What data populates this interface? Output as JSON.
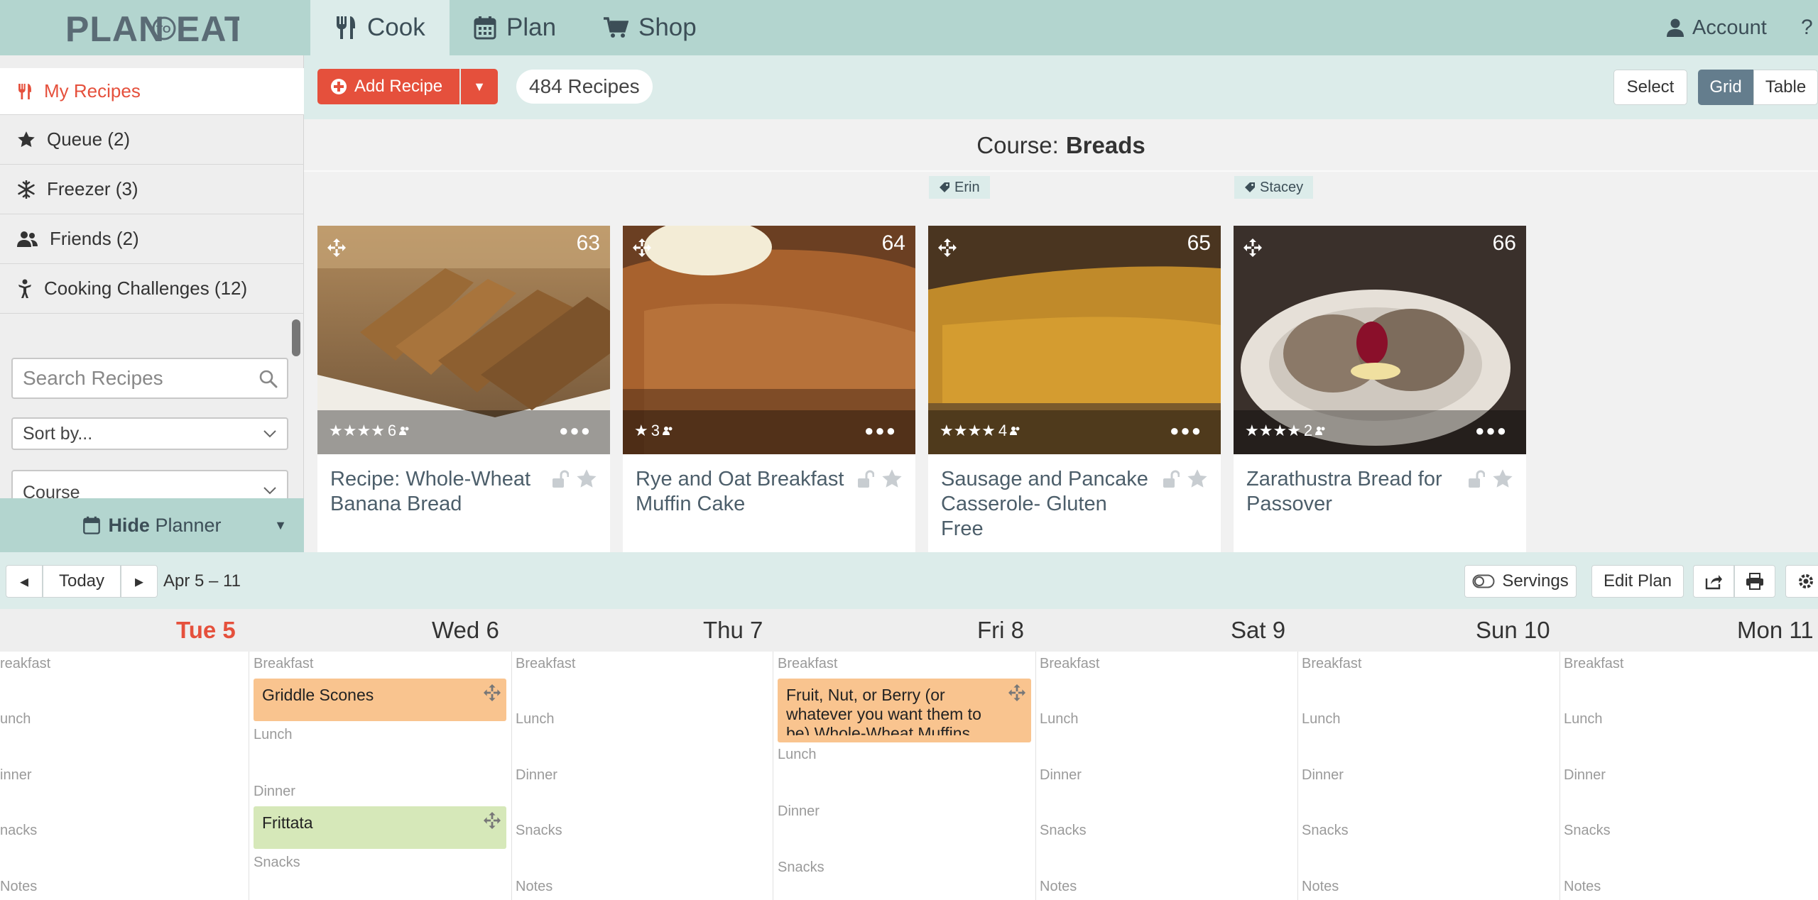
{
  "app": {
    "logo_text": "PLAN TO EAT"
  },
  "nav": {
    "tabs": [
      {
        "label": "Cook",
        "active": true
      },
      {
        "label": "Plan",
        "active": false
      },
      {
        "label": "Shop",
        "active": false
      }
    ],
    "account_label": "Account",
    "help_label": "?"
  },
  "sidebar": {
    "items": [
      {
        "label": "My Recipes",
        "icon": "fork-knife-icon",
        "active": true
      },
      {
        "label": "Queue (2)",
        "icon": "star-icon"
      },
      {
        "label": "Freezer (3)",
        "icon": "snowflake-icon"
      },
      {
        "label": "Friends (2)",
        "icon": "friends-icon"
      },
      {
        "label": "Cooking Challenges (12)",
        "icon": "challenge-icon"
      }
    ],
    "search_placeholder": "Search Recipes",
    "sort_value": "Sort by...",
    "course_value": "Course",
    "hide_planner_bold": "Hide",
    "hide_planner_rest": "Planner"
  },
  "toolbar": {
    "add_recipe_label": "Add Recipe",
    "recipe_count": "484 Recipes",
    "select_label": "Select",
    "grid_label": "Grid",
    "table_label": "Table",
    "active_view": "Grid"
  },
  "course_heading": {
    "prefix": "Course:",
    "value": "Breads"
  },
  "owner_tags": [
    "Erin",
    "Stacey"
  ],
  "recipes": [
    {
      "number": "63",
      "rating": "★★★★",
      "rating_count": "6",
      "title": "Recipe: Whole-Wheat Banana Bread"
    },
    {
      "number": "64",
      "rating": "★",
      "rating_count": "3",
      "title": "Rye and Oat Breakfast Muffin Cake"
    },
    {
      "number": "65",
      "rating": "★★★★",
      "rating_count": "4",
      "title": "Sausage and Pancake Casserole- Gluten Free"
    },
    {
      "number": "66",
      "rating": "★★★★",
      "rating_count": "2",
      "title": "Zarathustra Bread for Passover"
    }
  ],
  "planner": {
    "prev_label": "◂",
    "today_label": "Today",
    "next_label": "▸",
    "week_range": "Apr 5 – 11",
    "servings_label": "Servings",
    "edit_plan_label": "Edit Plan",
    "days": [
      {
        "dow": "Tue",
        "date": "5",
        "today": true
      },
      {
        "dow": "Wed",
        "date": "6"
      },
      {
        "dow": "Thu",
        "date": "7"
      },
      {
        "dow": "Fri",
        "date": "8"
      },
      {
        "dow": "Sat",
        "date": "9"
      },
      {
        "dow": "Sun",
        "date": "10"
      },
      {
        "dow": "Mon",
        "date": "11"
      }
    ],
    "slots": [
      "Breakfast",
      "Lunch",
      "Dinner",
      "Snacks",
      "Notes"
    ],
    "slots_truncated": [
      "reakfast",
      "unch",
      "inner",
      "nacks",
      "Notes"
    ],
    "meals": {
      "wed_breakfast": "Griddle Scones",
      "wed_dinner": "Frittata",
      "fri_breakfast": "Fruit, Nut, or Berry (or whatever you want them to be) Whole-Wheat Muffins"
    },
    "colors": {
      "breakfast_meal": "#f9c48f",
      "dinner_meal": "#d6e8b9",
      "today": "#e5503c",
      "accent": "#e5503c"
    }
  }
}
